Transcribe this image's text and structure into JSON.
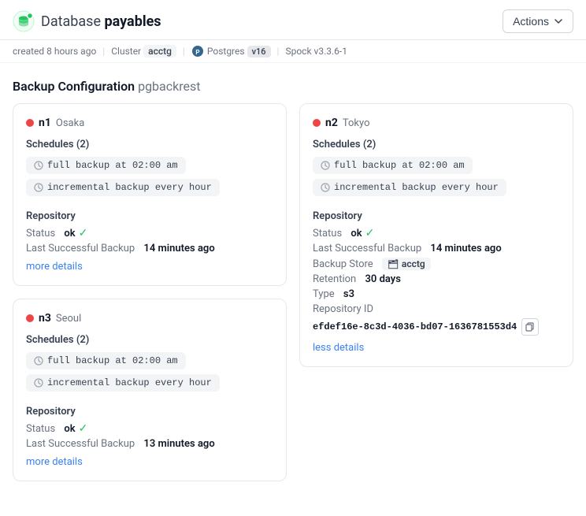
{
  "header": {
    "db_label": "Database",
    "db_name": "payables",
    "actions_label": "Actions"
  },
  "meta": {
    "created": "created 8 hours ago",
    "sep1": "|",
    "cluster_label": "Cluster",
    "cluster_name": "acctg",
    "sep2": "|",
    "db_type": "Postgres",
    "db_version": "v16",
    "sep3": "|",
    "plugin": "Spock",
    "plugin_version": "v3.3.6-1"
  },
  "backup_section": {
    "title": "Backup Configuration",
    "subtitle": "pgbackrest"
  },
  "nodes": [
    {
      "id": "n1",
      "city": "Osaka",
      "schedules_label": "Schedules (2)",
      "schedules": [
        "full backup at 02:00 am",
        "incremental backup every hour"
      ],
      "repo_label": "Repository",
      "status_label": "Status",
      "status_val": "ok",
      "last_backup_label": "Last Successful Backup",
      "last_backup_val": "14 minutes ago",
      "more_link": "more details",
      "show_extra": false
    },
    {
      "id": "n2",
      "city": "Tokyo",
      "schedules_label": "Schedules (2)",
      "schedules": [
        "full backup at 02:00 am",
        "incremental backup every hour"
      ],
      "repo_label": "Repository",
      "status_label": "Status",
      "status_val": "ok",
      "last_backup_label": "Last Successful Backup",
      "last_backup_val": "14 minutes ago",
      "backup_store_label": "Backup Store",
      "backup_store_val": "acctg",
      "retention_label": "Retention",
      "retention_val": "30 days",
      "type_label": "Type",
      "type_val": "s3",
      "repo_id_label": "Repository ID",
      "repo_id_val": "efdef16e-8c3d-4036-bd07-1636781553d4",
      "more_link": "less details",
      "show_extra": true
    },
    {
      "id": "n3",
      "city": "Seoul",
      "schedules_label": "Schedules (2)",
      "schedules": [
        "full backup at 02:00 am",
        "incremental backup every hour"
      ],
      "repo_label": "Repository",
      "status_label": "Status",
      "status_val": "ok",
      "last_backup_label": "Last Successful Backup",
      "last_backup_val": "13 minutes ago",
      "more_link": "more details",
      "show_extra": false
    }
  ]
}
